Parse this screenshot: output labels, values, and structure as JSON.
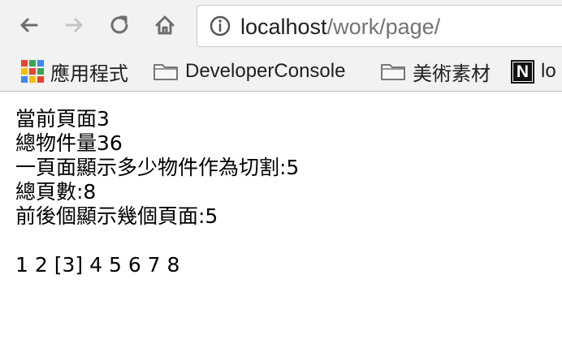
{
  "browser": {
    "url_host": "localhost",
    "url_path": "/work/page/",
    "bookmarks": [
      {
        "label": "應用程式",
        "icon": "apps-grid-icon"
      },
      {
        "label": "DeveloperConsole",
        "icon": "folder-icon"
      },
      {
        "label": "美術素材",
        "icon": "folder-icon"
      },
      {
        "label": "lo",
        "icon": "notion-icon"
      }
    ],
    "icon_names": {
      "back": "back-arrow-icon",
      "forward": "forward-arrow-icon",
      "reload": "reload-icon",
      "home": "home-icon",
      "info": "info-icon"
    }
  },
  "page": {
    "lines": [
      "當前頁面3",
      "總物件量36",
      "一頁面顯示多少物件作為切割:5",
      "總頁數:8",
      "前後個顯示幾個頁面:5"
    ],
    "pagination": {
      "items": [
        "1",
        "2",
        "[3]",
        "4",
        "5",
        "6",
        "7",
        "8"
      ],
      "current": "[3]"
    }
  },
  "colors": {
    "chrome_bg": "#f2f2f2",
    "url_host": "#1f1f1f",
    "url_path": "#737373"
  }
}
